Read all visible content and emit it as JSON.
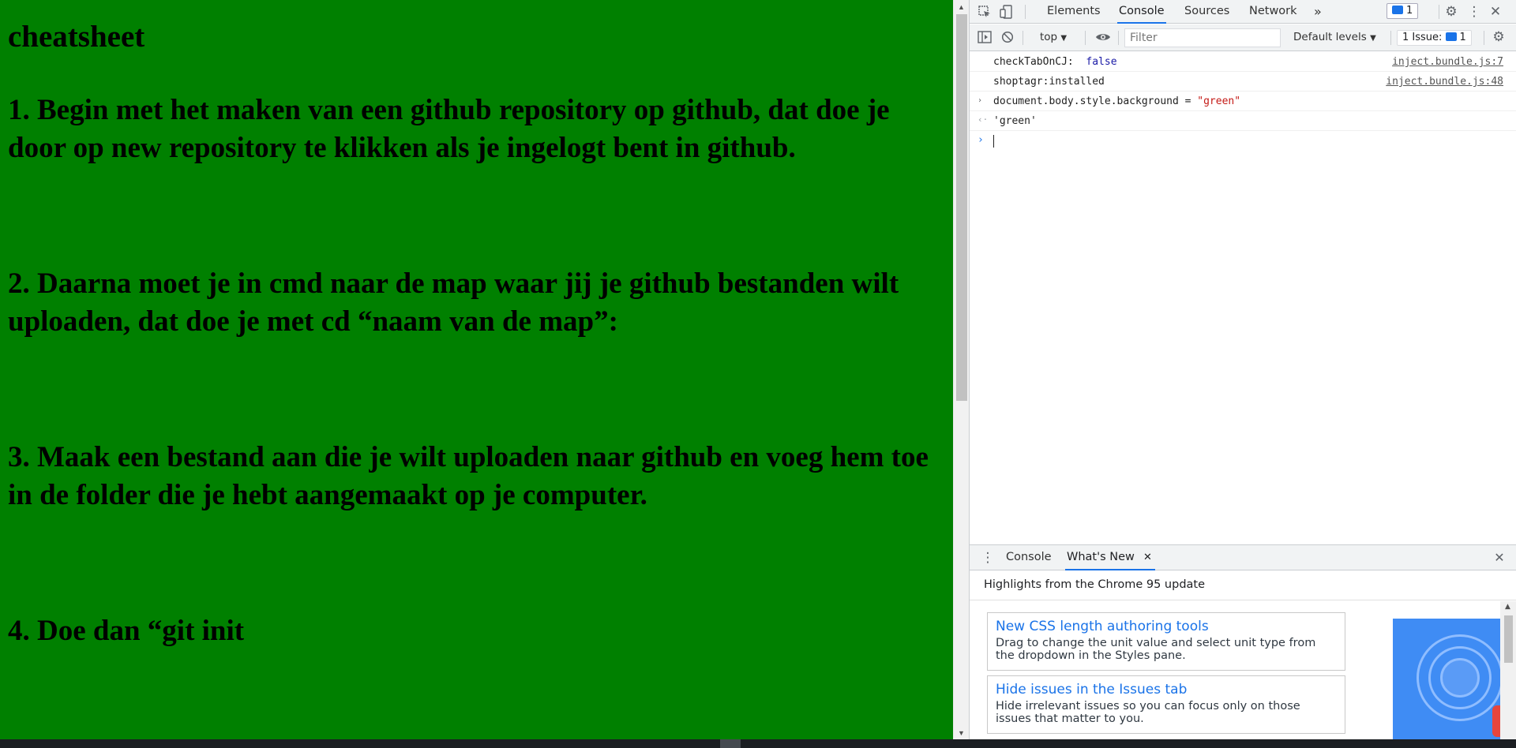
{
  "page": {
    "heading": "cheatsheet",
    "steps": [
      "1. Begin met het maken van een github repository op github, dat doe je door op new repository te klikken als je ingelogt bent in github.",
      "2. Daarna moet je in cmd naar de map waar jij je github bestanden wilt uploaden, dat doe je met cd “naam van de map”:",
      "3. Maak een bestand aan die je wilt uploaden naar github en voeg hem toe in de folder die je hebt aangemaakt op je computer.",
      "4. Doe dan “git init"
    ],
    "background": "#008000"
  },
  "devtools": {
    "tabs": [
      "Elements",
      "Console",
      "Sources",
      "Network"
    ],
    "active_tab": "Console",
    "more_tabs": "»",
    "issues_count": "1",
    "toolbar": {
      "context": "top",
      "filter_placeholder": "Filter",
      "levels": "Default levels",
      "issues_label": "1 Issue:",
      "issues_count": "1"
    },
    "console": {
      "log1_label": "checkTabOnCJ:",
      "log1_value": "false",
      "log1_source": "inject.bundle.js:7",
      "log2_text": "shoptagr:installed",
      "log2_source": "inject.bundle.js:48",
      "input_code": "document.body.style.background = ",
      "input_string": "\"green\"",
      "result": "'green'"
    },
    "drawer": {
      "tabs": [
        "Console",
        "What's New"
      ],
      "active_tab": "What's New",
      "title": "Highlights from the Chrome 95 update",
      "cards": [
        {
          "title": "New CSS length authoring tools",
          "desc": "Drag to change the unit value and select unit type from the dropdown in the Styles pane."
        },
        {
          "title": "Hide issues in the Issues tab",
          "desc": "Hide irrelevant issues so you can focus only on those issues that matter to you."
        }
      ]
    },
    "accent": "#1a73e8"
  },
  "icons": [
    "inspect-icon",
    "device-toolbar-icon",
    "settings-icon",
    "kebab-menu-icon",
    "close-icon",
    "sidebar-toggle-icon",
    "clear-console-icon",
    "eye-icon",
    "chevron-down-icon",
    "prompt-icon",
    "result-icon",
    "drawer-menu-icon"
  ]
}
